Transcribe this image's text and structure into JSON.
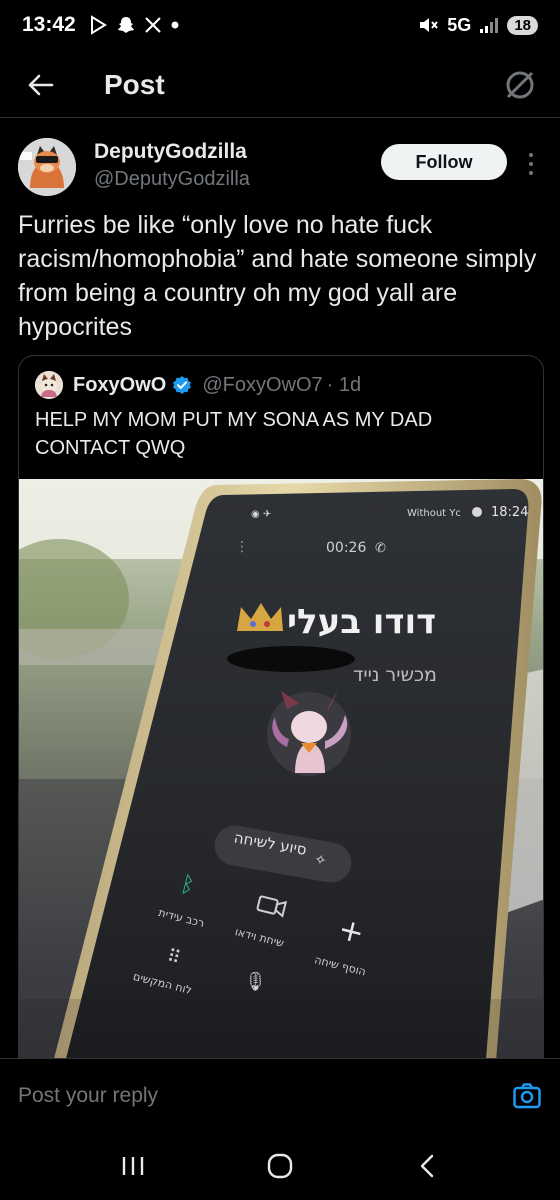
{
  "status_bar": {
    "time": "13:42",
    "left_icons": [
      "play-store-icon",
      "snapchat-icon",
      "x-icon",
      "dot-icon"
    ],
    "network": "5G",
    "battery": "18"
  },
  "header": {
    "title": "Post"
  },
  "tweet": {
    "display_name": "DeputyGodzilla",
    "handle": "@DeputyGodzilla",
    "follow_label": "Follow",
    "text": "Furries be like “only love no hate fuck racism/homophobia” and hate someone simply from being a country oh my god yall are hypocrites"
  },
  "quote": {
    "display_name": "FoxyOwO",
    "handle": "@FoxyOwO7",
    "time": "· 1d",
    "text": "HELP MY MOM PUT MY SONA AS MY DAD CONTACT QWQ",
    "photo": {
      "status_time": "18:24",
      "status_text": "Without Yc",
      "call_timer": "00:26",
      "contact_name": "דודו בעלי",
      "contact_sub": "מכשיר נייד",
      "assist_label": "סיוע לשיחה",
      "btn_bluetooth": "רכב עידית",
      "btn_video": "שיחת וידאו",
      "btn_add": "הוסף שיחה",
      "btn_keypad": "לוח המקשים"
    }
  },
  "reply": {
    "placeholder": "Post your reply"
  },
  "colors": {
    "background": "#000000",
    "accent": "#1d9bf0",
    "muted": "#71767b",
    "border": "#2f3336"
  }
}
